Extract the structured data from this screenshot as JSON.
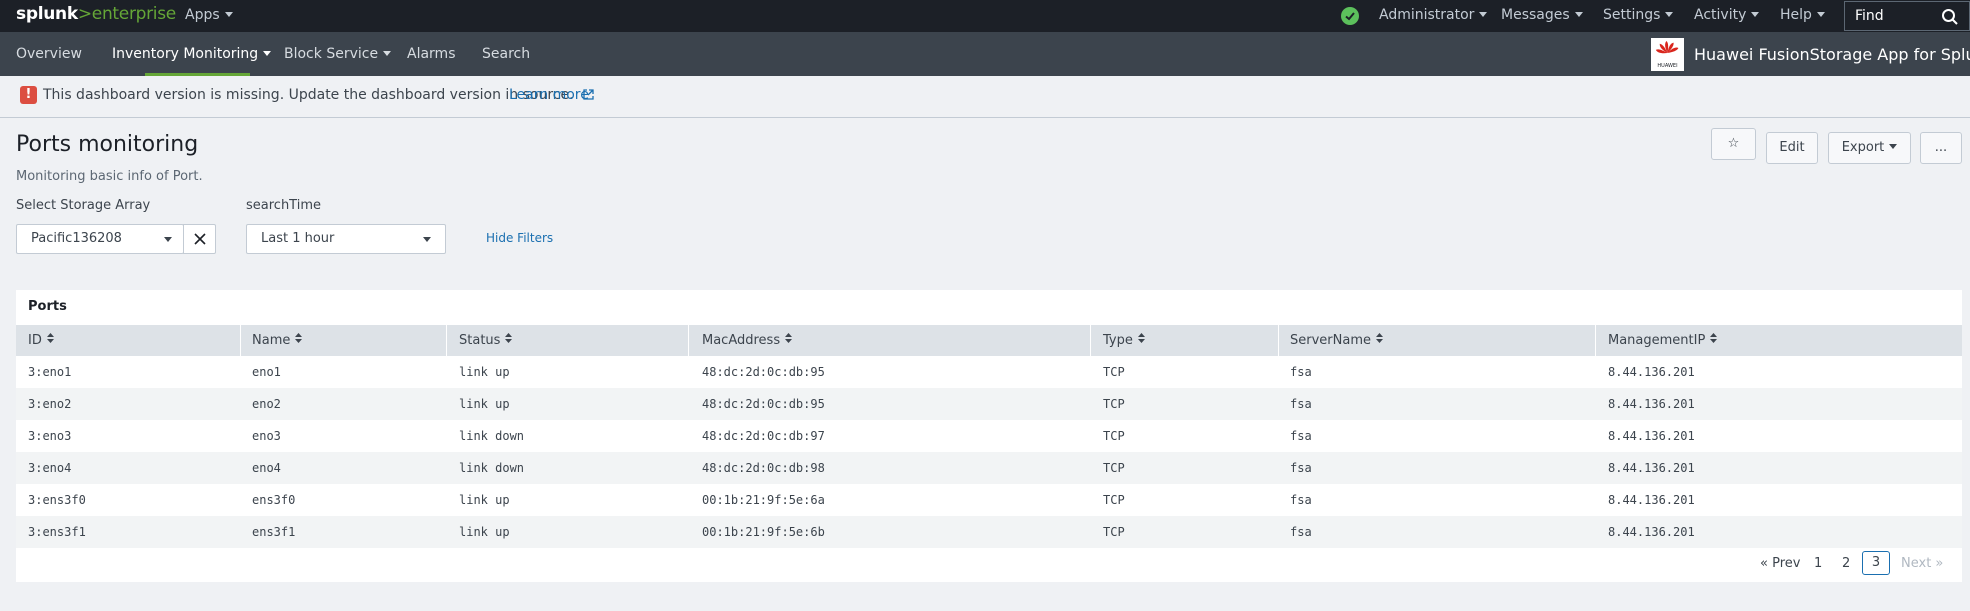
{
  "topbar": {
    "logo_splunk": "splunk",
    "logo_gt": ">",
    "logo_enterprise": "enterprise",
    "apps": "Apps",
    "administrator": "Administrator",
    "messages": "Messages",
    "settings": "Settings",
    "activity": "Activity",
    "help": "Help",
    "find": "Find",
    "status_color": "#5cc05c"
  },
  "appbar": {
    "overview": "Overview",
    "inventory_monitoring": "Inventory Monitoring",
    "block_service": "Block Service",
    "alarms": "Alarms",
    "search": "Search",
    "app_logo_text": "HUAWEI",
    "app_title": "Huawei FusionStorage App for Splunk",
    "accent_color": "#65a637"
  },
  "message": {
    "icon": "!",
    "text": "This dashboard version is missing. Update the dashboard version in source.",
    "link": "Learn more"
  },
  "dashboard": {
    "title": "Ports monitoring",
    "description": "Monitoring basic info of Port.",
    "star_icon": "☆",
    "edit": "Edit",
    "export": "Export",
    "more": "..."
  },
  "filters": {
    "storage_label": "Select Storage Array",
    "storage_value": "Pacific136208",
    "time_label": "searchTime",
    "time_value": "Last 1 hour",
    "hide_filters": "Hide Filters"
  },
  "table": {
    "title": "Ports",
    "columns": [
      "ID",
      "Name",
      "Status",
      "MacAddress",
      "Type",
      "ServerName",
      "ManagementIP"
    ],
    "rows": [
      [
        "3:eno1",
        "eno1",
        "link up",
        "48:dc:2d:0c:db:95",
        "TCP",
        "fsa",
        "8.44.136.201"
      ],
      [
        "3:eno2",
        "eno2",
        "link up",
        "48:dc:2d:0c:db:95",
        "TCP",
        "fsa",
        "8.44.136.201"
      ],
      [
        "3:eno3",
        "eno3",
        "link down",
        "48:dc:2d:0c:db:97",
        "TCP",
        "fsa",
        "8.44.136.201"
      ],
      [
        "3:eno4",
        "eno4",
        "link down",
        "48:dc:2d:0c:db:98",
        "TCP",
        "fsa",
        "8.44.136.201"
      ],
      [
        "3:ens3f0",
        "ens3f0",
        "link up",
        "00:1b:21:9f:5e:6a",
        "TCP",
        "fsa",
        "8.44.136.201"
      ],
      [
        "3:ens3f1",
        "ens3f1",
        "link up",
        "00:1b:21:9f:5e:6b",
        "TCP",
        "fsa",
        "8.44.136.201"
      ]
    ]
  },
  "pagination": {
    "prev": "« Prev",
    "pages": [
      "1",
      "2",
      "3"
    ],
    "current": "3",
    "next": "Next »"
  }
}
